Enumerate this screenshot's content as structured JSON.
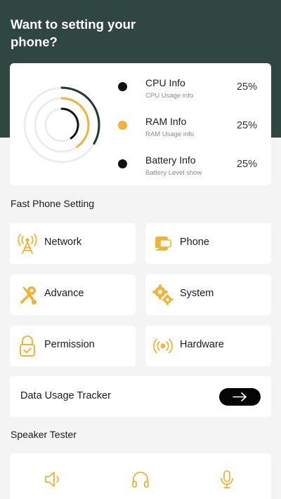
{
  "header": {
    "title": "Want to setting your phone?"
  },
  "stats": {
    "items": [
      {
        "title": "CPU Info",
        "subtitle": "CPU Usage info",
        "percent": "25%",
        "color": "#111111"
      },
      {
        "title": "RAM Info",
        "subtitle": "RAM Usage info",
        "percent": "25%",
        "color": "#f2b233"
      },
      {
        "title": "Battery Info",
        "subtitle": "Battery Level show",
        "percent": "25%",
        "color": "#111111"
      }
    ]
  },
  "fast_setting": {
    "title": "Fast Phone Setting",
    "tiles": [
      {
        "label": "Network",
        "icon": "network-tower-icon"
      },
      {
        "label": "Phone",
        "icon": "phone-icon"
      },
      {
        "label": "Advance",
        "icon": "tools-icon"
      },
      {
        "label": "System",
        "icon": "gears-icon"
      },
      {
        "label": "Permission",
        "icon": "lock-check-icon"
      },
      {
        "label": "Hardware",
        "icon": "broadcast-icon"
      }
    ]
  },
  "tracker": {
    "label": "Data Usage Tracker",
    "icon": "arrow-right-icon"
  },
  "speaker": {
    "title": "Speaker Tester",
    "icons": [
      "speaker-icon",
      "headphones-icon",
      "microphone-icon"
    ]
  },
  "colors": {
    "header": "#2f4740",
    "accent": "#f2b233",
    "dark": "#1e3a32"
  }
}
